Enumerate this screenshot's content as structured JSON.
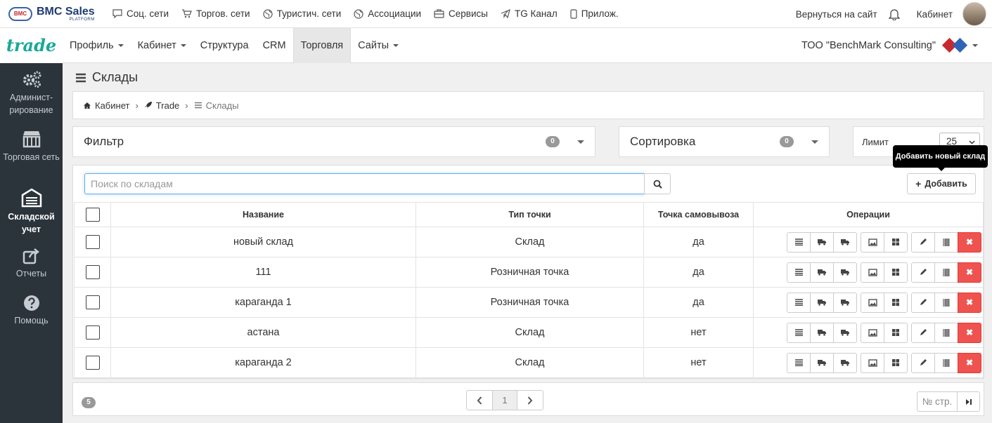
{
  "top": {
    "logo_mark": "BMC",
    "logo_main": "BMC Sales",
    "logo_sub": "PLATFORM",
    "nav": [
      {
        "label": "Соц. сети",
        "icon": "chat-icon"
      },
      {
        "label": "Торгов. сети",
        "icon": "cart-icon"
      },
      {
        "label": "Туристич. сети",
        "icon": "globe-icon"
      },
      {
        "label": "Ассоциации",
        "icon": "globe-icon"
      },
      {
        "label": "Сервисы",
        "icon": "briefcase-icon"
      },
      {
        "label": "TG Канал",
        "icon": "telegram-icon"
      },
      {
        "label": "Прилож.",
        "icon": "mobile-icon"
      }
    ],
    "back_link": "Вернуться на сайт",
    "cabinet": "Кабинет"
  },
  "second": {
    "brand": "trade",
    "menu": [
      {
        "label": "Профиль",
        "dropdown": true
      },
      {
        "label": "Кабинет",
        "dropdown": true
      },
      {
        "label": "Структура",
        "dropdown": false
      },
      {
        "label": "CRM",
        "dropdown": false
      },
      {
        "label": "Торговля",
        "dropdown": false,
        "active": true
      },
      {
        "label": "Сайты",
        "dropdown": true
      }
    ],
    "company": "ТОО \"BenchMark Consulting\""
  },
  "sidebar": [
    {
      "label": "Админист-рирование",
      "icon": "gears-icon"
    },
    {
      "label": "Торговая сеть",
      "icon": "store-icon"
    },
    {
      "label": "Складской учет",
      "icon": "warehouse-icon",
      "active": true
    },
    {
      "label": "Отчеты",
      "icon": "share-icon"
    },
    {
      "label": "Помощь",
      "icon": "help-icon"
    }
  ],
  "page": {
    "title": "Склады",
    "breadcrumb": [
      "Кабинет",
      "Trade",
      "Склады"
    ]
  },
  "filter": {
    "title": "Фильтр",
    "count": "0"
  },
  "sort": {
    "title": "Сортировка",
    "count": "0"
  },
  "limit": {
    "label": "Лимит",
    "value": "25"
  },
  "tooltip": "Добавить новый склад",
  "search": {
    "placeholder": "Поиск по складам"
  },
  "add_label": "Добавить",
  "table": {
    "headers": [
      "Название",
      "Тип точки",
      "Точка самовывоза",
      "Операции"
    ],
    "rows": [
      {
        "name": "новый склад",
        "type": "Склад",
        "pickup": "да"
      },
      {
        "name": "111",
        "type": "Розничная точка",
        "pickup": "да"
      },
      {
        "name": "караганда 1",
        "type": "Розничная точка",
        "pickup": "да"
      },
      {
        "name": "астана",
        "type": "Склад",
        "pickup": "нет"
      },
      {
        "name": "караганда 2",
        "type": "Склад",
        "pickup": "нет"
      }
    ]
  },
  "pager": {
    "total": "5",
    "current": "1",
    "page_no_label": "№ стр."
  }
}
